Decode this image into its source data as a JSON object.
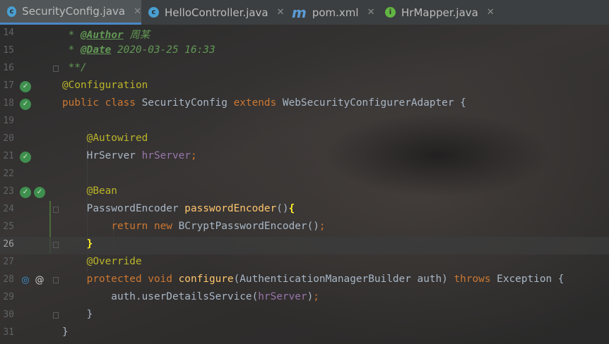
{
  "tabs": [
    {
      "label": "SecurityConfig.java",
      "icon": "c",
      "active": true
    },
    {
      "label": "HelloController.java",
      "icon": "c",
      "active": false
    },
    {
      "label": "pom.xml",
      "icon": "m",
      "active": false
    },
    {
      "label": "HrMapper.java",
      "icon": "i",
      "active": false
    }
  ],
  "close_glyph": "✕",
  "lines": [
    {
      "n": "14",
      "code": [
        [
          "cmt",
          " * "
        ],
        [
          "tag",
          "@Author"
        ],
        [
          "cmt",
          " 周某"
        ]
      ]
    },
    {
      "n": "15",
      "code": [
        [
          "cmt",
          " * "
        ],
        [
          "tag",
          "@Date"
        ],
        [
          "cmt",
          " 2020-03-25 16:33"
        ]
      ]
    },
    {
      "n": "16",
      "code": [
        [
          "cmt",
          " **/"
        ]
      ]
    },
    {
      "n": "17",
      "code": [
        [
          "ann",
          "@Configuration"
        ]
      ],
      "gutter": [
        "bean"
      ]
    },
    {
      "n": "18",
      "code": [
        [
          "kw",
          "public class "
        ],
        [
          "pl",
          "SecurityConfig "
        ],
        [
          "kw",
          "extends "
        ],
        [
          "pl",
          "WebSecurityConfigurerAdapter {"
        ]
      ],
      "gutter": [
        "bean"
      ]
    },
    {
      "n": "19",
      "code": []
    },
    {
      "n": "20",
      "code": [
        [
          "pl",
          "    "
        ],
        [
          "ann",
          "@Autowired"
        ]
      ]
    },
    {
      "n": "21",
      "code": [
        [
          "pl",
          "    HrServer "
        ],
        [
          "fld",
          "hrServer"
        ],
        [
          "kw",
          ";"
        ]
      ],
      "gutter": [
        "bean"
      ]
    },
    {
      "n": "22",
      "code": []
    },
    {
      "n": "23",
      "code": [
        [
          "pl",
          "    "
        ],
        [
          "ann",
          "@Bean"
        ]
      ],
      "gutter": [
        "bean",
        "bean"
      ]
    },
    {
      "n": "24",
      "code": [
        [
          "pl",
          "    PasswordEncoder "
        ],
        [
          "mth",
          "passwordEncoder"
        ],
        [
          "pl",
          "()"
        ],
        [
          "brace",
          "{"
        ]
      ]
    },
    {
      "n": "25",
      "code": [
        [
          "pl",
          "        "
        ],
        [
          "kw",
          "return new "
        ],
        [
          "pl",
          "BCryptPasswordEncoder()"
        ],
        [
          "kw",
          ";"
        ]
      ]
    },
    {
      "n": "26",
      "code": [
        [
          "pl",
          "    "
        ],
        [
          "brace",
          "}"
        ]
      ],
      "current": true
    },
    {
      "n": "27",
      "code": [
        [
          "pl",
          "    "
        ],
        [
          "ann",
          "@Override"
        ]
      ]
    },
    {
      "n": "28",
      "code": [
        [
          "pl",
          "    "
        ],
        [
          "kw",
          "protected void "
        ],
        [
          "mth",
          "configure"
        ],
        [
          "pl",
          "(AuthenticationManagerBuilder auth) "
        ],
        [
          "kw",
          "throws "
        ],
        [
          "pl",
          "Exception {"
        ]
      ],
      "gutter": [
        "override",
        "at"
      ]
    },
    {
      "n": "29",
      "code": [
        [
          "pl",
          "        auth.userDetailsService("
        ],
        [
          "fld",
          "hrServer"
        ],
        [
          "pl",
          ")"
        ],
        [
          "kw",
          ";"
        ]
      ]
    },
    {
      "n": "30",
      "code": [
        [
          "pl",
          "    }"
        ]
      ]
    },
    {
      "n": "31",
      "code": [
        [
          "pl",
          "}"
        ]
      ]
    }
  ],
  "fold_lines": [
    "16",
    "24",
    "26",
    "28",
    "30"
  ],
  "colors": {
    "keyword": "#cc7832",
    "annotation": "#bbb529",
    "field": "#9876aa",
    "method": "#ffc66d",
    "comment": "#629755",
    "text": "#a9b7c6",
    "background": "#2b2b2b"
  }
}
